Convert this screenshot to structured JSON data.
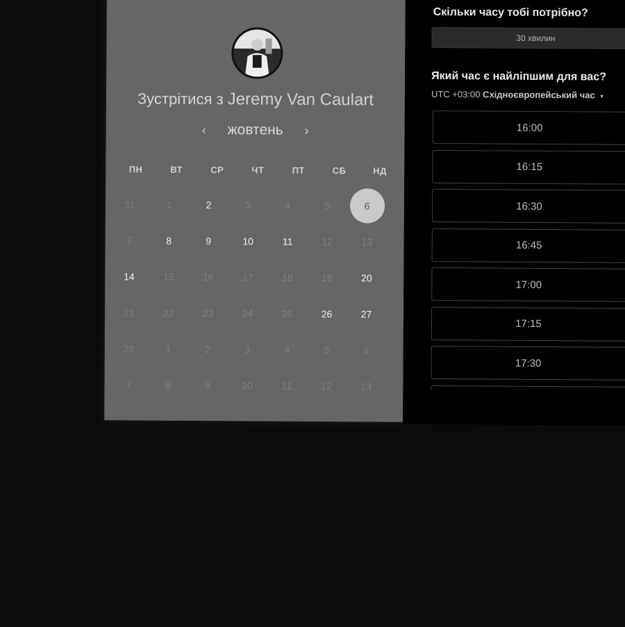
{
  "calendar": {
    "title_prefix": "Зустрітися з",
    "host_name": "Jeremy Van Caulart",
    "month": "жовтень",
    "prev_icon": "‹",
    "next_icon": "›",
    "weekdays": [
      "ПН",
      "ВТ",
      "СР",
      "ЧТ",
      "ПТ",
      "СБ",
      "НД"
    ],
    "days": [
      {
        "d": "31",
        "state": "disabled"
      },
      {
        "d": "1",
        "state": "disabled"
      },
      {
        "d": "2",
        "state": "available"
      },
      {
        "d": "3",
        "state": "disabled"
      },
      {
        "d": "4",
        "state": "disabled"
      },
      {
        "d": "5",
        "state": "disabled"
      },
      {
        "d": "6",
        "state": "selected"
      },
      {
        "d": "7",
        "state": "disabled"
      },
      {
        "d": "8",
        "state": "available"
      },
      {
        "d": "9",
        "state": "available"
      },
      {
        "d": "10",
        "state": "available"
      },
      {
        "d": "11",
        "state": "available"
      },
      {
        "d": "12",
        "state": "disabled"
      },
      {
        "d": "13",
        "state": "disabled"
      },
      {
        "d": "14",
        "state": "available"
      },
      {
        "d": "15",
        "state": "disabled"
      },
      {
        "d": "16",
        "state": "disabled"
      },
      {
        "d": "17",
        "state": "disabled"
      },
      {
        "d": "18",
        "state": "disabled"
      },
      {
        "d": "19",
        "state": "disabled"
      },
      {
        "d": "20",
        "state": "available"
      },
      {
        "d": "21",
        "state": "disabled"
      },
      {
        "d": "22",
        "state": "disabled"
      },
      {
        "d": "23",
        "state": "disabled"
      },
      {
        "d": "24",
        "state": "disabled"
      },
      {
        "d": "25",
        "state": "disabled"
      },
      {
        "d": "26",
        "state": "available"
      },
      {
        "d": "27",
        "state": "available"
      },
      {
        "d": "28",
        "state": "disabled"
      },
      {
        "d": "1",
        "state": "disabled"
      },
      {
        "d": "2",
        "state": "disabled"
      },
      {
        "d": "3",
        "state": "disabled"
      },
      {
        "d": "4",
        "state": "disabled"
      },
      {
        "d": "5",
        "state": "disabled"
      },
      {
        "d": "6",
        "state": "disabled"
      },
      {
        "d": "7",
        "state": "disabled"
      },
      {
        "d": "8",
        "state": "disabled"
      },
      {
        "d": "9",
        "state": "disabled"
      },
      {
        "d": "10",
        "state": "disabled"
      },
      {
        "d": "11",
        "state": "disabled"
      },
      {
        "d": "12",
        "state": "disabled"
      },
      {
        "d": "13",
        "state": "disabled"
      }
    ]
  },
  "booking": {
    "duration_question": "Скільки часу тобі потрібно?",
    "duration_value": "30 хвилин",
    "time_question": "Який час є найліпшим для вас?",
    "timezone_offset": "UTC +03:00",
    "timezone_name": "Східноєвропейський час",
    "timezone_caret": "▾",
    "slots": [
      "16:00",
      "16:15",
      "16:30",
      "16:45",
      "17:00",
      "17:15",
      "17:30",
      ""
    ]
  }
}
